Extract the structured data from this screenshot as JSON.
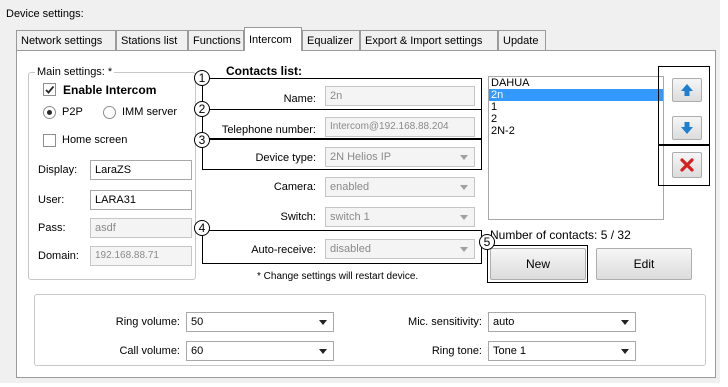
{
  "window": {
    "title": "Device settings:"
  },
  "tabs": [
    {
      "label": "Network settings",
      "active": false
    },
    {
      "label": "Stations list",
      "active": false
    },
    {
      "label": "Functions",
      "active": false
    },
    {
      "label": "Intercom",
      "active": true
    },
    {
      "label": "Equalizer",
      "active": false
    },
    {
      "label": "Export & Import settings",
      "active": false
    },
    {
      "label": "Update",
      "active": false
    }
  ],
  "main_settings": {
    "title": "Main settings: *",
    "enable_intercom": {
      "label": "Enable Intercom",
      "checked": true
    },
    "mode": [
      {
        "label": "P2P",
        "selected": true
      },
      {
        "label": "IMM server",
        "selected": false
      }
    ],
    "home_screen": {
      "label": "Home screen",
      "checked": false
    },
    "display": {
      "label": "Display:",
      "value": "LaraZS"
    },
    "user": {
      "label": "User:",
      "value": "LARA31"
    },
    "pass": {
      "label": "Pass:",
      "value": "asdf"
    },
    "domain": {
      "label": "Domain:",
      "value": "192.168.88.71"
    }
  },
  "contacts": {
    "title": "Contacts list:",
    "name": {
      "label": "Name:",
      "value": "2n"
    },
    "telephone": {
      "label": "Telephone number:",
      "value": "Intercom@192.168.88.204"
    },
    "device_type": {
      "label": "Device type:",
      "value": "2N Helios IP"
    },
    "camera": {
      "label": "Camera:",
      "value": "enabled"
    },
    "switch": {
      "label": "Switch:",
      "value": "switch 1"
    },
    "auto_receive": {
      "label": "Auto-receive:",
      "value": "disabled"
    },
    "note": "* Change settings will restart device.",
    "list": [
      {
        "label": "DAHUA",
        "selected": false
      },
      {
        "label": "2n",
        "selected": true
      },
      {
        "label": "1",
        "selected": false
      },
      {
        "label": "2",
        "selected": false
      },
      {
        "label": "2N-2",
        "selected": false
      }
    ],
    "count_text": "Number of contacts: 5 / 32",
    "new_label": "New",
    "edit_label": "Edit"
  },
  "callouts": [
    "1",
    "2",
    "3",
    "4",
    "5"
  ],
  "icons": {
    "up": "arrow-up-icon",
    "down": "arrow-down-icon",
    "delete": "delete-x-icon"
  },
  "colors": {
    "accent": "#3399ff",
    "icon_blue": "#1e7fd0",
    "delete_red": "#d32020"
  },
  "bottom": {
    "ring_volume": {
      "label": "Ring volume:",
      "value": "50"
    },
    "call_volume": {
      "label": "Call volume:",
      "value": "60"
    },
    "mic_sensitivity": {
      "label": "Mic. sensitivity:",
      "value": "auto"
    },
    "ring_tone": {
      "label": "Ring tone:",
      "value": "Tone 1"
    }
  }
}
